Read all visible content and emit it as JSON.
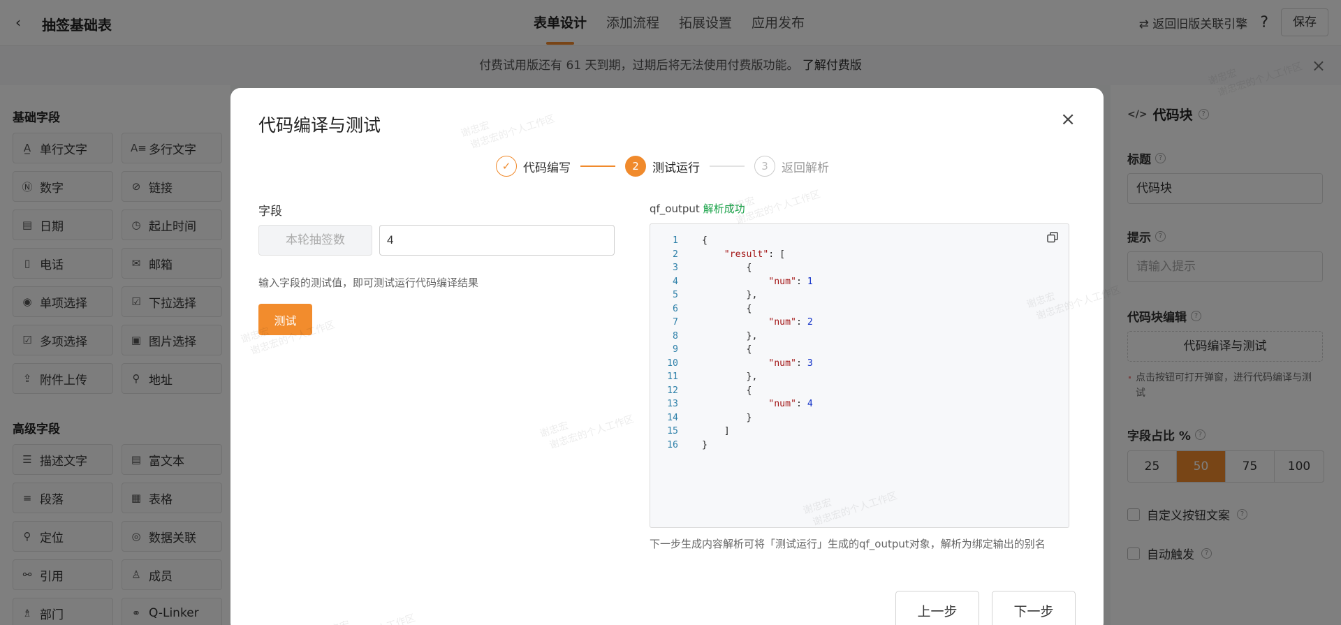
{
  "header": {
    "back_label": "‹",
    "title": "抽签基础表",
    "tabs": [
      {
        "label": "表单设计",
        "active": true
      },
      {
        "label": "添加流程",
        "active": false
      },
      {
        "label": "拓展设置",
        "active": false
      },
      {
        "label": "应用发布",
        "active": false
      }
    ],
    "legacy_link": "⇄ 返回旧版关联引擎",
    "help_icon": "?",
    "save_label": "保存"
  },
  "notice": {
    "text": "付费试用版还有 61 天到期，过期后将无法使用付费版功能。",
    "link": "了解付费版",
    "close_icon": "×"
  },
  "left_panel": {
    "basic_title": "基础字段",
    "basic_fields": [
      {
        "icon": "A̲",
        "label": "单行文字"
      },
      {
        "icon": "A≡",
        "label": "多行文字"
      },
      {
        "icon": "Ⓝ",
        "label": "数字"
      },
      {
        "icon": "⊘",
        "label": "链接"
      },
      {
        "icon": "▤",
        "label": "日期"
      },
      {
        "icon": "◷",
        "label": "起止时间"
      },
      {
        "icon": "▯",
        "label": "电话"
      },
      {
        "icon": "✉",
        "label": "邮箱"
      },
      {
        "icon": "◉",
        "label": "单项选择"
      },
      {
        "icon": "☑",
        "label": "下拉选择"
      },
      {
        "icon": "☑",
        "label": "多项选择"
      },
      {
        "icon": "▣",
        "label": "图片选择"
      },
      {
        "icon": "⇪",
        "label": "附件上传"
      },
      {
        "icon": "⚲",
        "label": "地址"
      }
    ],
    "advanced_title": "高级字段",
    "advanced_fields": [
      {
        "icon": "☰",
        "label": "描述文字"
      },
      {
        "icon": "▤",
        "label": "富文本"
      },
      {
        "icon": "≡",
        "label": "段落"
      },
      {
        "icon": "▦",
        "label": "表格"
      },
      {
        "icon": "⚲",
        "label": "定位"
      },
      {
        "icon": "◎",
        "label": "数据关联"
      },
      {
        "icon": "⚯",
        "label": "引用"
      },
      {
        "icon": "♙",
        "label": "成员"
      },
      {
        "icon": "♗",
        "label": "部门"
      },
      {
        "icon": "⚭",
        "label": "Q-Linker"
      }
    ]
  },
  "right_panel": {
    "header_icon": "</>",
    "header": "代码块",
    "title_label": "标题",
    "title_value": "代码块",
    "hint_label": "提示",
    "hint_placeholder": "请输入提示",
    "code_label": "代码块编辑",
    "code_button": "代码编译与测试",
    "code_hint": "点击按钮可打开弹窗，进行代码编译与测试",
    "ratio_label": "字段占比 %",
    "ratio_options": [
      "25",
      "50",
      "75",
      "100"
    ],
    "ratio_selected": "50",
    "custom_button_label": "自定义按钮文案",
    "auto_trigger_label": "自动触发"
  },
  "modal": {
    "title": "代码编译与测试",
    "close_icon": "×",
    "steps": [
      {
        "index": "✓",
        "label": "代码编写",
        "state": "done"
      },
      {
        "index": "2",
        "label": "测试运行",
        "state": "active"
      },
      {
        "index": "3",
        "label": "返回解析",
        "state": "wait"
      }
    ],
    "field_label": "字段",
    "field_name": "本轮抽签数",
    "field_value": "4",
    "field_hint": "输入字段的测试值，即可测试运行代码编译结果",
    "test_button": "测试",
    "output_label": "qf_output",
    "output_status": "解析成功",
    "code_lines": [
      "{",
      "    \"result\": [",
      "        {",
      "            \"num\": 1",
      "        },",
      "        {",
      "            \"num\": 2",
      "        },",
      "        {",
      "            \"num\": 3",
      "        },",
      "        {",
      "            \"num\": 4",
      "        }",
      "    ]",
      "}"
    ],
    "output_note": "下一步生成内容解析可将「测试运行」生成的qf_output对象，解析为绑定输出的别名",
    "prev_button": "上一步",
    "next_button": "下一步"
  },
  "watermark": {
    "line1": "谢忠宏",
    "line2": "谢忠宏的个人工作区"
  }
}
